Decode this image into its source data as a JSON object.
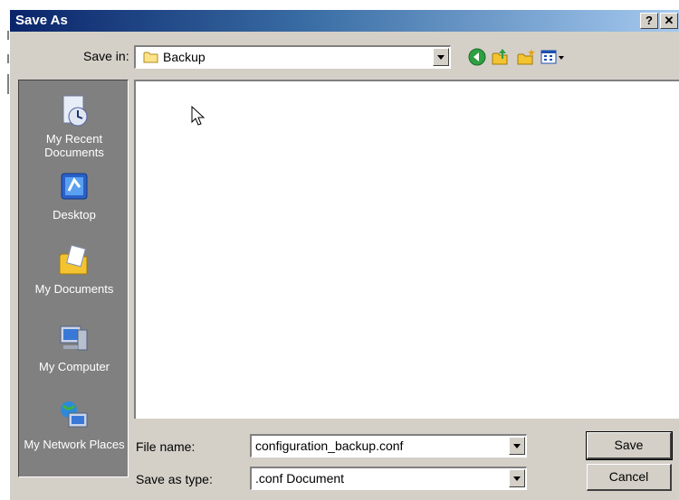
{
  "window": {
    "title": "Save As",
    "help_label": "?",
    "close_label": "✕"
  },
  "save_in": {
    "label": "Save in:",
    "value": "Backup"
  },
  "toolbar": {
    "icons": [
      "back-icon",
      "up-folder-icon",
      "new-folder-icon",
      "view-menu-icon"
    ]
  },
  "places": [
    {
      "label": "My Recent Documents",
      "icon": "recent-documents-icon"
    },
    {
      "label": "Desktop",
      "icon": "desktop-icon"
    },
    {
      "label": "My Documents",
      "icon": "my-documents-icon"
    },
    {
      "label": "My Computer",
      "icon": "my-computer-icon"
    },
    {
      "label": "My Network Places",
      "icon": "network-places-icon"
    }
  ],
  "file_name": {
    "label": "File name:",
    "value": "configuration_backup.conf"
  },
  "save_as_type": {
    "label": "Save as type:",
    "value": ".conf Document"
  },
  "buttons": {
    "save": "Save",
    "cancel": "Cancel"
  }
}
